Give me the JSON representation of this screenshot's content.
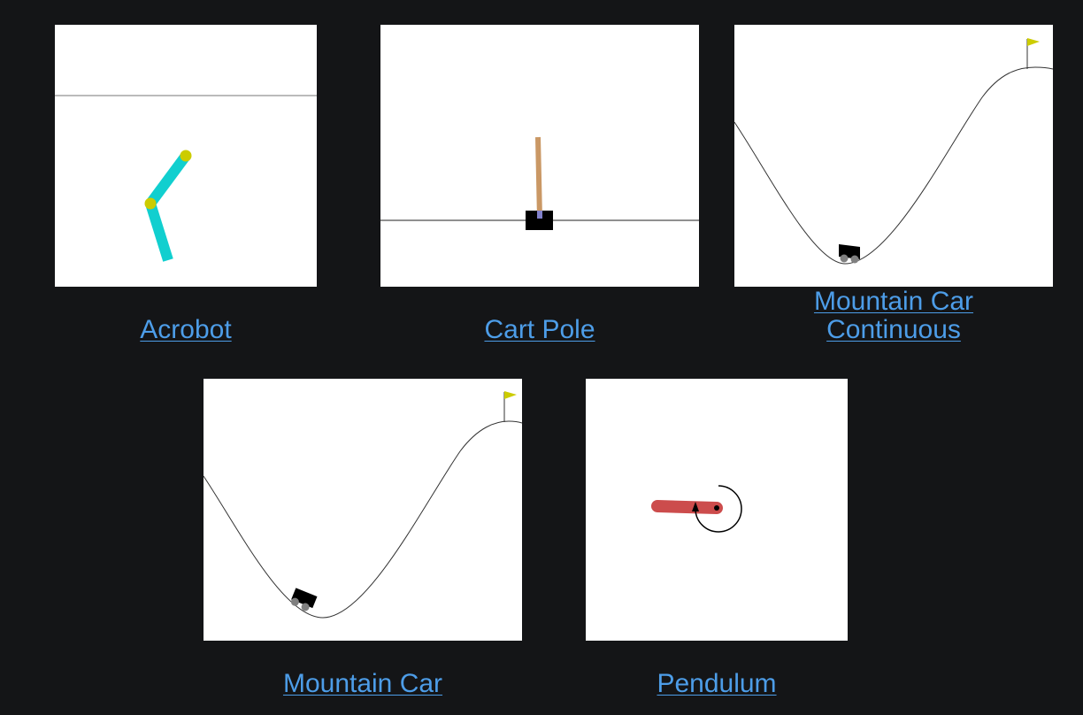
{
  "environments": [
    {
      "id": "acrobot",
      "label": "Acrobot"
    },
    {
      "id": "cartpole",
      "label": "Cart Pole"
    },
    {
      "id": "mountain_car_continuous",
      "label_line1": "Mountain Car",
      "label_line2": "Continuous"
    },
    {
      "id": "mountain_car",
      "label": "Mountain Car"
    },
    {
      "id": "pendulum",
      "label": "Pendulum"
    }
  ],
  "colors": {
    "page_background": "#141517",
    "link": "#4d9de8",
    "acrobot_link": "#11cfcf",
    "acrobot_joint": "#cccc00",
    "cartpole_pole": "#ca9865",
    "cartpole_axle": "#8181cb",
    "car_body": "#000000",
    "car_wheel": "#808080",
    "flag": "#cccc00",
    "pendulum_rod": "#cc4c4c"
  }
}
